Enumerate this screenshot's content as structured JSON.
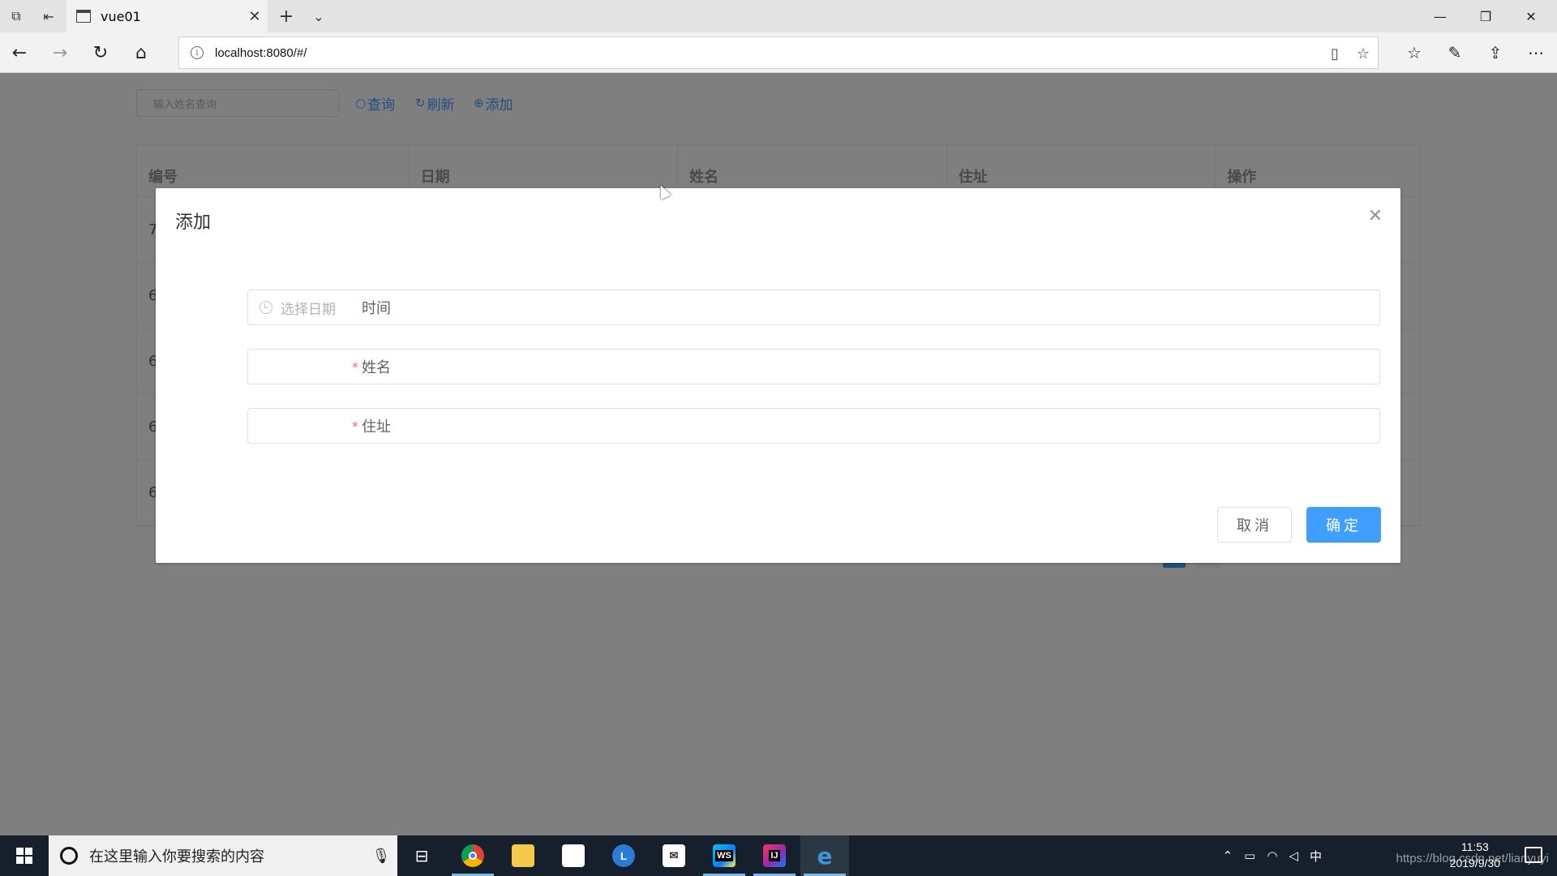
{
  "browser": {
    "tab_title": "vue01",
    "url": "localhost:8080/#/"
  },
  "toolbar": {
    "search_placeholder": "输入姓名查询",
    "query_label": "查询",
    "refresh_label": "刷新",
    "add_label": "添加"
  },
  "table": {
    "headers": [
      "编号",
      "日期",
      "姓名",
      "住址",
      "操作"
    ],
    "rows": [
      "7",
      "6",
      "6",
      "6",
      "6"
    ]
  },
  "dialog": {
    "title": "添加",
    "fields": [
      {
        "label": "时间",
        "placeholder": "选择日期",
        "required": false
      },
      {
        "label": "姓名",
        "placeholder": "",
        "required": true
      },
      {
        "label": "住址",
        "placeholder": "",
        "required": true
      }
    ],
    "cancel_label": "取消",
    "ok_label": "确定"
  },
  "taskbar": {
    "search_text": "在这里输入你要搜索的内容",
    "time": "11:53",
    "date": "2019/9/30",
    "ime": "中",
    "apps": [
      "chrome-icon",
      "file-explorer-icon",
      "store-icon",
      "clock-app-icon",
      "mail-icon",
      "webstorm-icon",
      "intellij-icon",
      "edge-icon"
    ]
  },
  "watermark": "https://blog.csdn.net/lianyuyi",
  "colors": {
    "primary": "#409eff",
    "required": "#f56c6c",
    "taskbar": "#16202c"
  }
}
